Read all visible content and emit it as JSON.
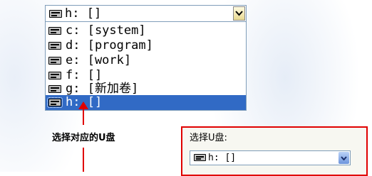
{
  "combo": {
    "selected_value": "h: []"
  },
  "dropdown": {
    "items": [
      {
        "label": "c: [system]"
      },
      {
        "label": "d: [program]"
      },
      {
        "label": "e: [work]"
      },
      {
        "label": "f: []"
      },
      {
        "label": "g: [新加卷]"
      },
      {
        "label": "h: []",
        "selected": true
      }
    ]
  },
  "annotation": {
    "caption": "选择对应的U盘"
  },
  "panel": {
    "label": "选择U盘:",
    "combo_value": "h: []"
  },
  "colors": {
    "selection": "#316ac5",
    "annotation_red": "#e00000",
    "border": "#7f9db9"
  },
  "icons": [
    "drive-icon",
    "chevron-down-icon",
    "arrow-up-icon"
  ]
}
